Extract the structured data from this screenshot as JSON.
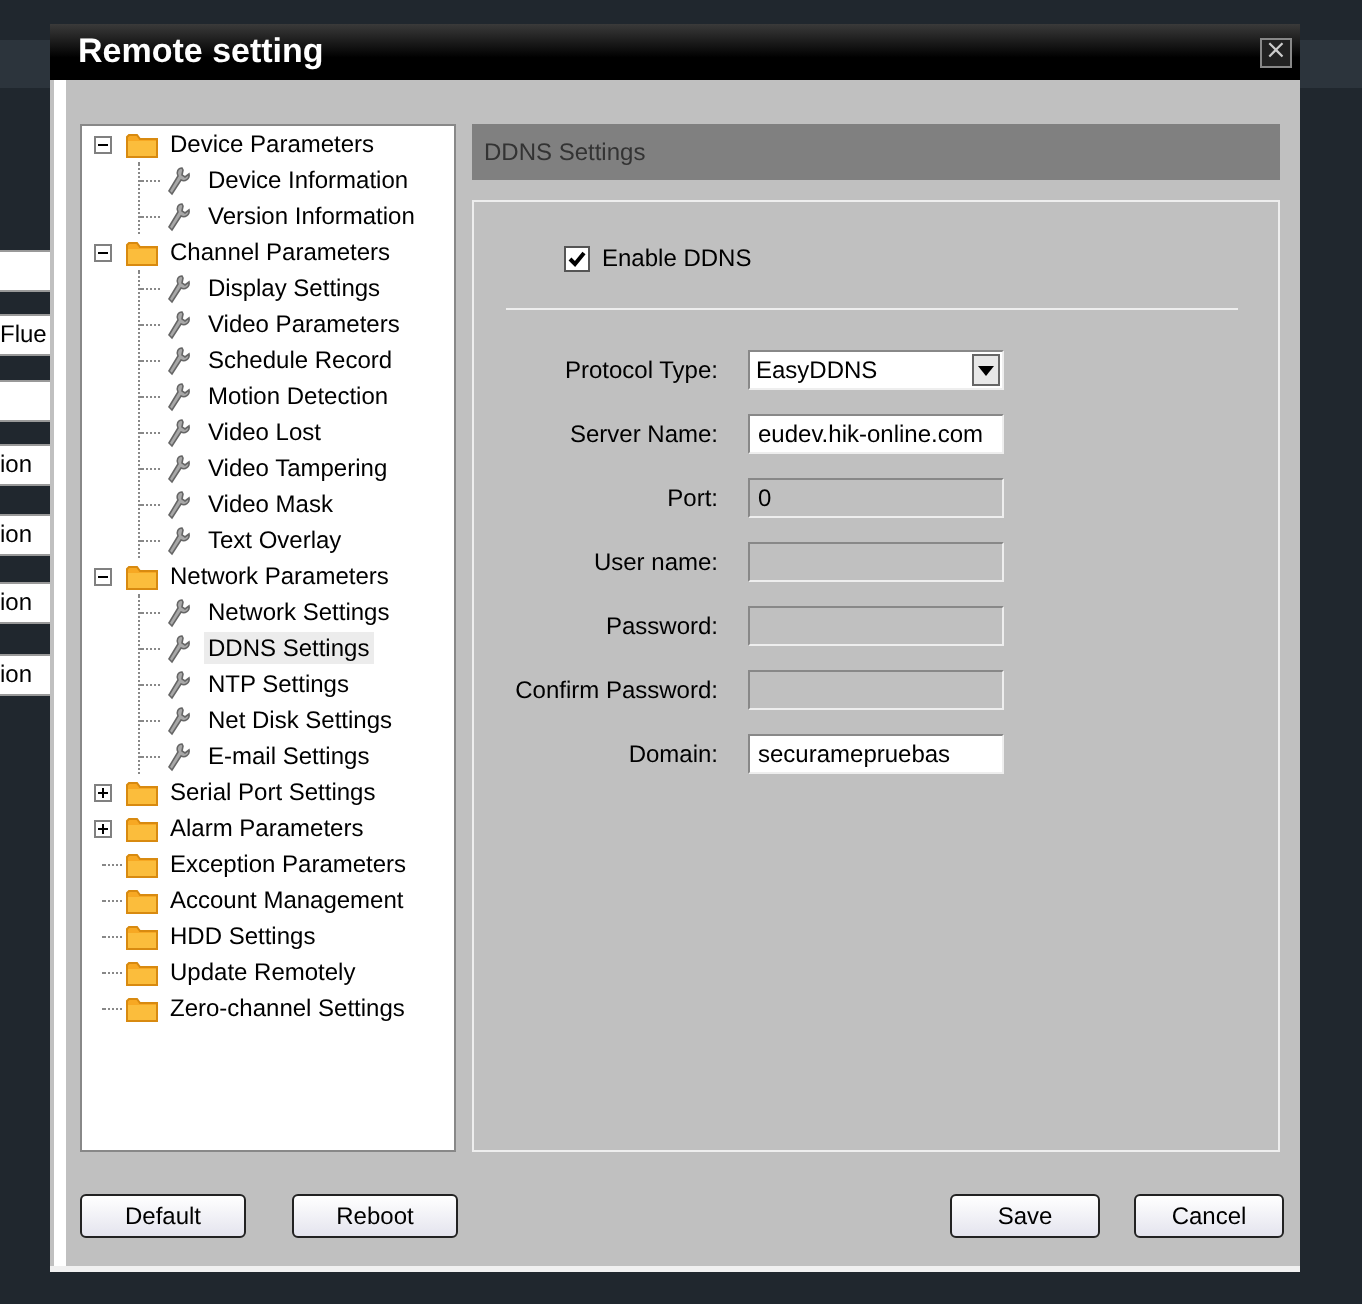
{
  "background_fields": [
    {
      "value": "Flue"
    },
    {
      "value": "ion"
    },
    {
      "value": "ion"
    },
    {
      "value": "ion"
    },
    {
      "value": "ion"
    }
  ],
  "window": {
    "title": "Remote setting",
    "close": "×"
  },
  "tree": [
    {
      "label": "Device Parameters",
      "kind": "group",
      "expanded": true,
      "selected": false,
      "children": [
        {
          "label": "Device Information",
          "kind": "leaf",
          "selected": false
        },
        {
          "label": "Version Information",
          "kind": "leaf",
          "selected": false
        }
      ]
    },
    {
      "label": "Channel Parameters",
      "kind": "group",
      "expanded": true,
      "selected": false,
      "children": [
        {
          "label": "Display Settings",
          "kind": "leaf",
          "selected": false
        },
        {
          "label": "Video Parameters",
          "kind": "leaf",
          "selected": false
        },
        {
          "label": "Schedule Record",
          "kind": "leaf",
          "selected": false
        },
        {
          "label": "Motion Detection",
          "kind": "leaf",
          "selected": false
        },
        {
          "label": "Video Lost",
          "kind": "leaf",
          "selected": false
        },
        {
          "label": "Video Tampering",
          "kind": "leaf",
          "selected": false
        },
        {
          "label": "Video Mask",
          "kind": "leaf",
          "selected": false
        },
        {
          "label": "Text Overlay",
          "kind": "leaf",
          "selected": false
        }
      ]
    },
    {
      "label": "Network Parameters",
      "kind": "group",
      "expanded": true,
      "selected": false,
      "children": [
        {
          "label": "Network Settings",
          "kind": "leaf",
          "selected": false
        },
        {
          "label": "DDNS Settings",
          "kind": "leaf",
          "selected": true
        },
        {
          "label": "NTP Settings",
          "kind": "leaf",
          "selected": false
        },
        {
          "label": "Net Disk Settings",
          "kind": "leaf",
          "selected": false
        },
        {
          "label": "E-mail Settings",
          "kind": "leaf",
          "selected": false
        }
      ]
    },
    {
      "label": "Serial Port Settings",
      "kind": "group",
      "expanded": false,
      "selected": false
    },
    {
      "label": "Alarm Parameters",
      "kind": "group",
      "expanded": false,
      "selected": false
    },
    {
      "label": "Exception Parameters",
      "kind": "folder",
      "selected": false
    },
    {
      "label": "Account Management",
      "kind": "folder",
      "selected": false
    },
    {
      "label": "HDD Settings",
      "kind": "folder",
      "selected": false
    },
    {
      "label": "Update Remotely",
      "kind": "folder",
      "selected": false
    },
    {
      "label": "Zero-channel Settings",
      "kind": "folder",
      "selected": false
    }
  ],
  "panel": {
    "title": "DDNS Settings",
    "enable": {
      "label": "Enable DDNS",
      "checked": true
    },
    "fields": [
      {
        "label": "Protocol Type:",
        "kind": "select",
        "value": "EasyDDNS",
        "disabled": false
      },
      {
        "label": "Server Name:",
        "kind": "input",
        "value": "eudev.hik-online.com",
        "disabled": false
      },
      {
        "label": "Port:",
        "kind": "input",
        "value": "0",
        "disabled": true
      },
      {
        "label": "User name:",
        "kind": "input",
        "disabled": true
      },
      {
        "label": "Password:",
        "kind": "input",
        "disabled": true
      },
      {
        "label": "Confirm Password:",
        "kind": "input",
        "disabled": true
      },
      {
        "label": "Domain:",
        "kind": "input",
        "value": "securamepruebas",
        "disabled": false
      }
    ]
  },
  "buttons_left": [
    "Default",
    "Reboot"
  ],
  "buttons_right": [
    "Save",
    "Cancel"
  ]
}
